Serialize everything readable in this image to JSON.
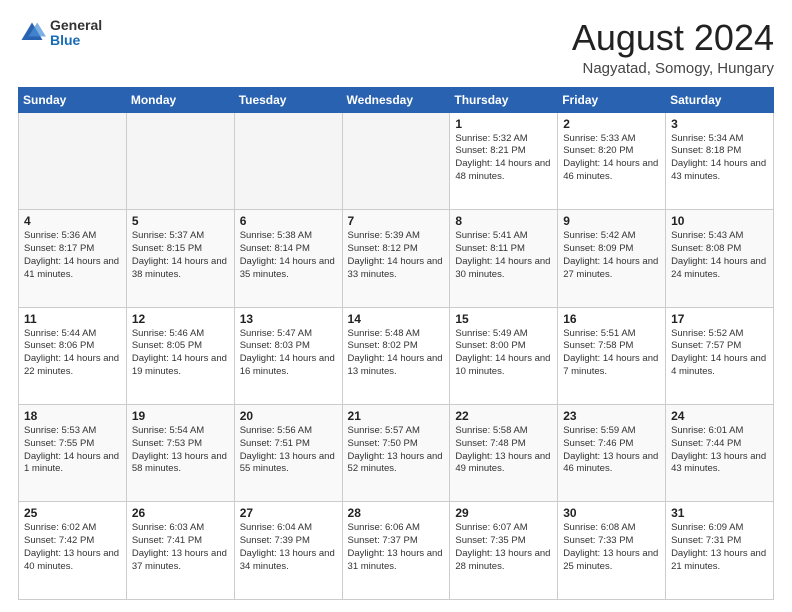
{
  "header": {
    "logo_general": "General",
    "logo_blue": "Blue",
    "month_title": "August 2024",
    "location": "Nagyatad, Somogy, Hungary"
  },
  "days_of_week": [
    "Sunday",
    "Monday",
    "Tuesday",
    "Wednesday",
    "Thursday",
    "Friday",
    "Saturday"
  ],
  "weeks": [
    [
      {
        "day": "",
        "empty": true
      },
      {
        "day": "",
        "empty": true
      },
      {
        "day": "",
        "empty": true
      },
      {
        "day": "",
        "empty": true
      },
      {
        "day": "1",
        "sunrise": "5:32 AM",
        "sunset": "8:21 PM",
        "daylight": "14 hours and 48 minutes."
      },
      {
        "day": "2",
        "sunrise": "5:33 AM",
        "sunset": "8:20 PM",
        "daylight": "14 hours and 46 minutes."
      },
      {
        "day": "3",
        "sunrise": "5:34 AM",
        "sunset": "8:18 PM",
        "daylight": "14 hours and 43 minutes."
      }
    ],
    [
      {
        "day": "4",
        "sunrise": "5:36 AM",
        "sunset": "8:17 PM",
        "daylight": "14 hours and 41 minutes."
      },
      {
        "day": "5",
        "sunrise": "5:37 AM",
        "sunset": "8:15 PM",
        "daylight": "14 hours and 38 minutes."
      },
      {
        "day": "6",
        "sunrise": "5:38 AM",
        "sunset": "8:14 PM",
        "daylight": "14 hours and 35 minutes."
      },
      {
        "day": "7",
        "sunrise": "5:39 AM",
        "sunset": "8:12 PM",
        "daylight": "14 hours and 33 minutes."
      },
      {
        "day": "8",
        "sunrise": "5:41 AM",
        "sunset": "8:11 PM",
        "daylight": "14 hours and 30 minutes."
      },
      {
        "day": "9",
        "sunrise": "5:42 AM",
        "sunset": "8:09 PM",
        "daylight": "14 hours and 27 minutes."
      },
      {
        "day": "10",
        "sunrise": "5:43 AM",
        "sunset": "8:08 PM",
        "daylight": "14 hours and 24 minutes."
      }
    ],
    [
      {
        "day": "11",
        "sunrise": "5:44 AM",
        "sunset": "8:06 PM",
        "daylight": "14 hours and 22 minutes."
      },
      {
        "day": "12",
        "sunrise": "5:46 AM",
        "sunset": "8:05 PM",
        "daylight": "14 hours and 19 minutes."
      },
      {
        "day": "13",
        "sunrise": "5:47 AM",
        "sunset": "8:03 PM",
        "daylight": "14 hours and 16 minutes."
      },
      {
        "day": "14",
        "sunrise": "5:48 AM",
        "sunset": "8:02 PM",
        "daylight": "14 hours and 13 minutes."
      },
      {
        "day": "15",
        "sunrise": "5:49 AM",
        "sunset": "8:00 PM",
        "daylight": "14 hours and 10 minutes."
      },
      {
        "day": "16",
        "sunrise": "5:51 AM",
        "sunset": "7:58 PM",
        "daylight": "14 hours and 7 minutes."
      },
      {
        "day": "17",
        "sunrise": "5:52 AM",
        "sunset": "7:57 PM",
        "daylight": "14 hours and 4 minutes."
      }
    ],
    [
      {
        "day": "18",
        "sunrise": "5:53 AM",
        "sunset": "7:55 PM",
        "daylight": "14 hours and 1 minute."
      },
      {
        "day": "19",
        "sunrise": "5:54 AM",
        "sunset": "7:53 PM",
        "daylight": "13 hours and 58 minutes."
      },
      {
        "day": "20",
        "sunrise": "5:56 AM",
        "sunset": "7:51 PM",
        "daylight": "13 hours and 55 minutes."
      },
      {
        "day": "21",
        "sunrise": "5:57 AM",
        "sunset": "7:50 PM",
        "daylight": "13 hours and 52 minutes."
      },
      {
        "day": "22",
        "sunrise": "5:58 AM",
        "sunset": "7:48 PM",
        "daylight": "13 hours and 49 minutes."
      },
      {
        "day": "23",
        "sunrise": "5:59 AM",
        "sunset": "7:46 PM",
        "daylight": "13 hours and 46 minutes."
      },
      {
        "day": "24",
        "sunrise": "6:01 AM",
        "sunset": "7:44 PM",
        "daylight": "13 hours and 43 minutes."
      }
    ],
    [
      {
        "day": "25",
        "sunrise": "6:02 AM",
        "sunset": "7:42 PM",
        "daylight": "13 hours and 40 minutes."
      },
      {
        "day": "26",
        "sunrise": "6:03 AM",
        "sunset": "7:41 PM",
        "daylight": "13 hours and 37 minutes."
      },
      {
        "day": "27",
        "sunrise": "6:04 AM",
        "sunset": "7:39 PM",
        "daylight": "13 hours and 34 minutes."
      },
      {
        "day": "28",
        "sunrise": "6:06 AM",
        "sunset": "7:37 PM",
        "daylight": "13 hours and 31 minutes."
      },
      {
        "day": "29",
        "sunrise": "6:07 AM",
        "sunset": "7:35 PM",
        "daylight": "13 hours and 28 minutes."
      },
      {
        "day": "30",
        "sunrise": "6:08 AM",
        "sunset": "7:33 PM",
        "daylight": "13 hours and 25 minutes."
      },
      {
        "day": "31",
        "sunrise": "6:09 AM",
        "sunset": "7:31 PM",
        "daylight": "13 hours and 21 minutes."
      }
    ]
  ]
}
